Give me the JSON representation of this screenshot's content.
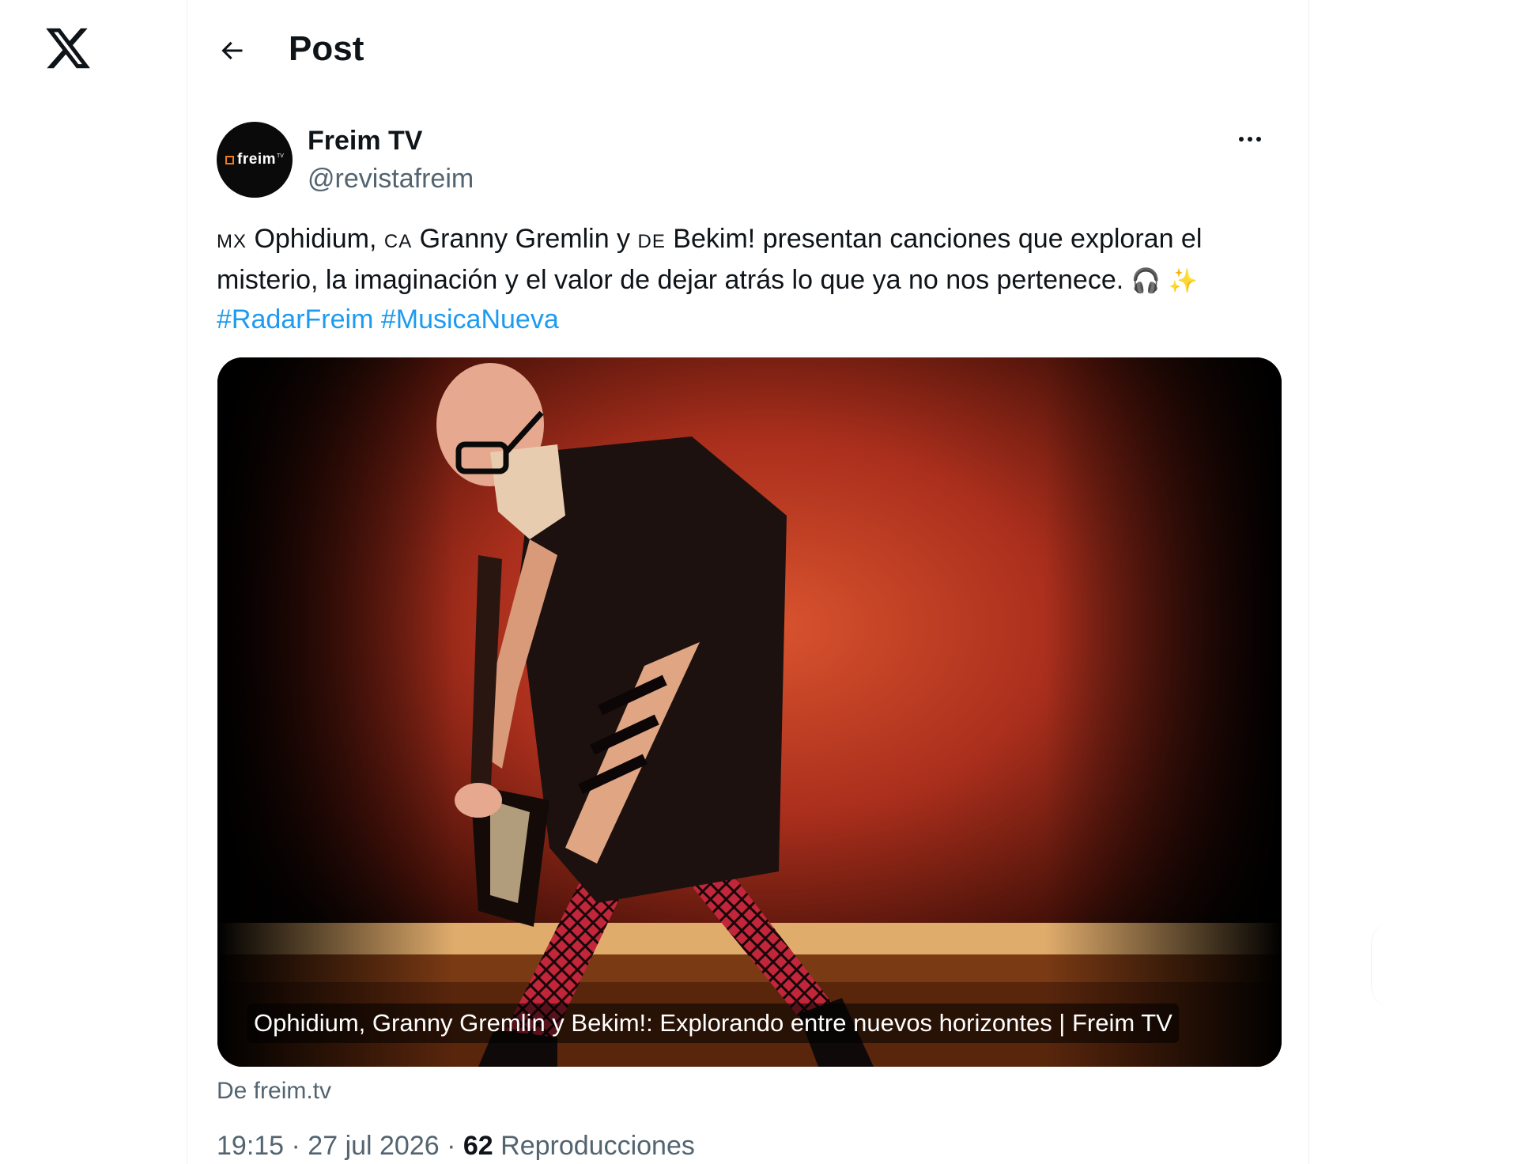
{
  "app": {
    "brand": "X"
  },
  "header": {
    "title": "Post",
    "back_icon": "arrow-left-icon"
  },
  "post": {
    "author": {
      "name": "Freim TV",
      "handle": "@revistafreim",
      "avatar_text": "freim",
      "avatar_sup": "TV"
    },
    "text": {
      "flag1": "MX",
      "artist1": " Ophidium, ",
      "flag2": "CA",
      "artist2": " Granny Gremlin y ",
      "flag3": "DE",
      "artist3": " Bekim! presentan canciones que exploran el misterio, la imaginación y el valor de dejar atrás lo que ya no nos pertenece. ",
      "emoji1": "🎧",
      "emoji2": "✨",
      "hashtags": [
        "#RadarFreim",
        "#MusicaNueva"
      ]
    },
    "media": {
      "caption": "Ophidium, Granny Gremlin y Bekim!: Explorando entre nuevos horizontes | Freim TV"
    },
    "source": "De freim.tv",
    "timestamp": "19:15 · 27 jul 2026 · ",
    "views_count": "62",
    "views_label": " Reproducciones"
  },
  "colors": {
    "accent": "#1d9bf0",
    "secondary_text": "#536471",
    "primary_text": "#0f1419",
    "avatar_bg": "#0a0a0a",
    "avatar_accent": "#f07c1e"
  }
}
